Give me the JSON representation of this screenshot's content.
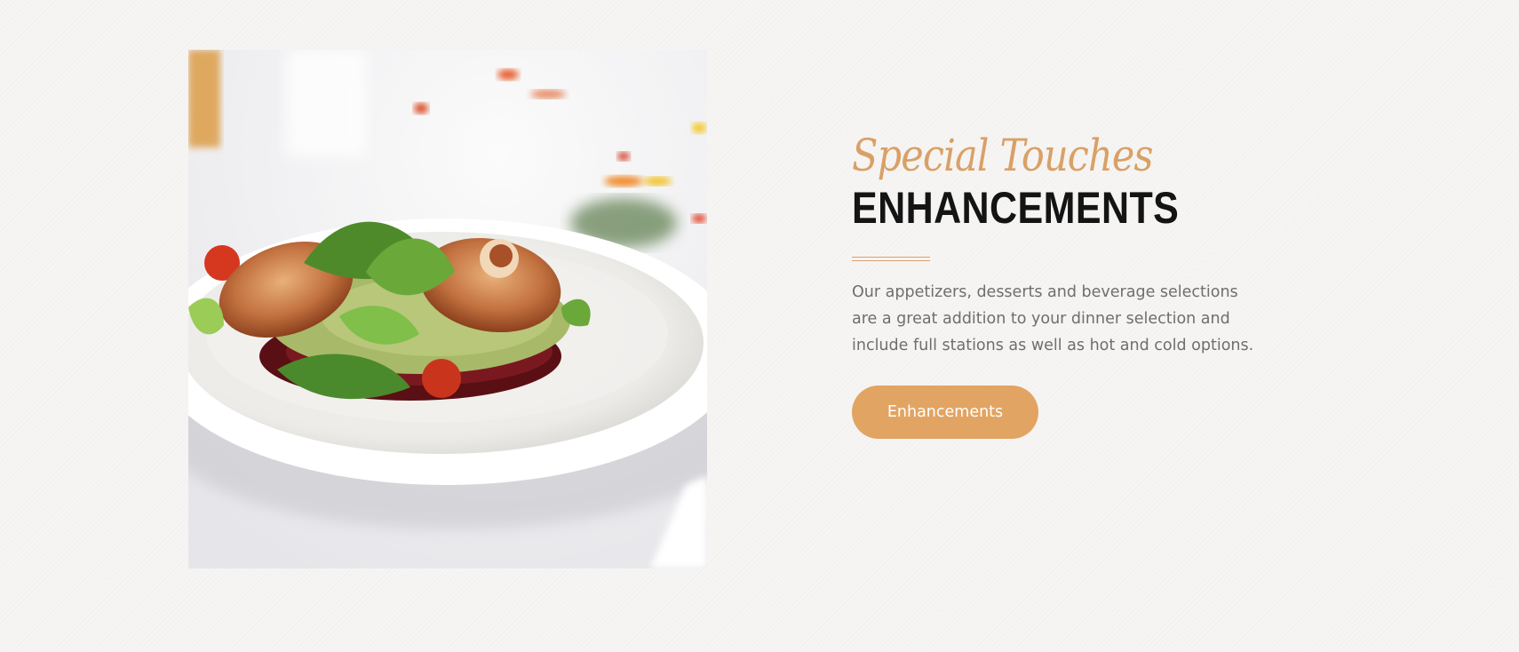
{
  "enhancements": {
    "script_title": "Special Touches",
    "title": "ENHANCEMENTS",
    "description": "Our appetizers, desserts and beverage selections are a great addition to your dinner selection and include full stations as well as hot and cold options.",
    "button_label": "Enhancements"
  },
  "photo": {
    "icon": "plated-dish-photo"
  },
  "colors": {
    "accent": "#e2a462",
    "script": "#d9a066",
    "title": "#141414",
    "body_text": "#6e6e6e",
    "background": "#f6f5f3"
  }
}
